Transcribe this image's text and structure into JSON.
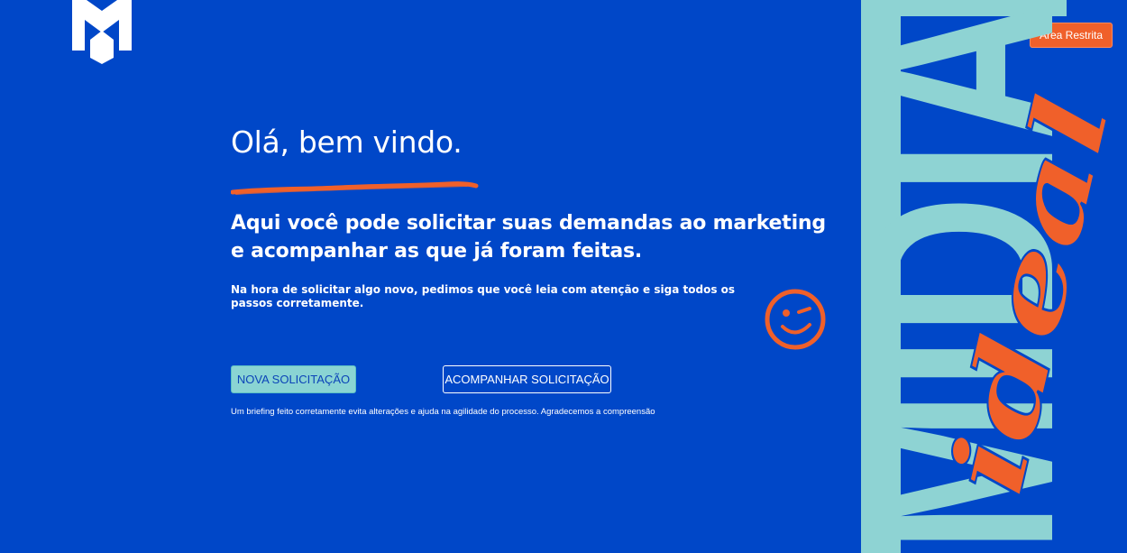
{
  "header": {
    "logo_icon": "m-monogram-logo-icon",
    "restricted_label": "Área Restrita"
  },
  "hero": {
    "title": "Olá, bem vindo.",
    "subtitle": "Aqui você pode solicitar suas demandas ao marketing e acompanhar as que já foram feitas.",
    "notice": "Na hora de solicitar algo novo, pedimos que você leia com atenção e siga todos os passos corretamente.",
    "footnote": "Um briefing feito corretamente evita alterações e ajuda na agilidade do processo. Agradecemos a compreensão"
  },
  "actions": {
    "new_request": "NOVA SOLICITAÇÃO",
    "track_request": "ACOMPANHAR SOLICITAÇÃO"
  },
  "decor": {
    "smiley_icon": "winking-smiley-icon",
    "brand_block_word": "MÍDIA",
    "brand_script_word": "ideal"
  },
  "colors": {
    "background": "#0047c8",
    "accent_orange": "#f0602a",
    "aqua": "#8ed3d3"
  }
}
